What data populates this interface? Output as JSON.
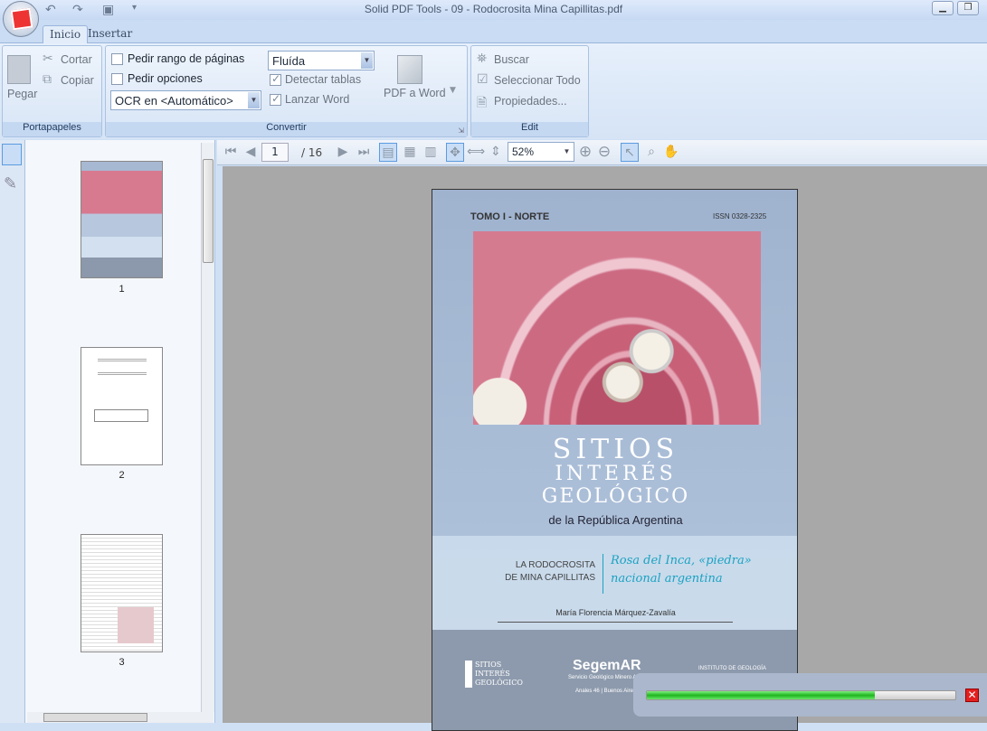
{
  "window": {
    "title": "Solid PDF Tools - 09 - Rodocrosita Mina Capillitas.pdf"
  },
  "tabs": [
    {
      "label": "Inicio",
      "active": true
    },
    {
      "label": "Insertar",
      "active": false
    }
  ],
  "ribbon": {
    "portapapeles": {
      "label": "Portapapeles",
      "paste": "Pegar",
      "cut": "Cortar",
      "copy": "Copiar"
    },
    "convertir": {
      "label": "Convertir",
      "page_range": "Pedir rango de páginas",
      "page_range_checked": false,
      "options": "Pedir opciones",
      "options_checked": false,
      "ocr": "OCR en <Automático>",
      "mode": "Fluída",
      "detect_tables": "Detectar tablas",
      "detect_tables_checked": true,
      "launch_word": "Lanzar Word",
      "launch_word_checked": true,
      "pdf_to_word": "PDF a Word"
    },
    "edit": {
      "label": "Edit",
      "search": "Buscar",
      "select_all": "Seleccionar Todo",
      "properties": "Propiedades..."
    }
  },
  "navigation": {
    "current_page": "1",
    "total_pages": "/ 16",
    "zoom": "52%"
  },
  "thumbnails": [
    {
      "label": "1"
    },
    {
      "label": "2"
    },
    {
      "label": "3"
    }
  ],
  "cover": {
    "tomo": "TOMO I - NORTE",
    "issn": "ISSN 0328-2325",
    "title1": "SITIOS",
    "title2": "INTERÉS",
    "title3": "GEOLÓGICO",
    "subtitle": "de la República Argentina",
    "topic1": "LA RODOCROSITA",
    "topic2": "DE MINA CAPILLITAS",
    "headline1": "Rosa del Inca, «piedra»",
    "headline2": "nacional argentina",
    "author": "María Florencia Márquez-Zavalía",
    "logo_left": "SITIOS INTERÉS GEOLÓGICO",
    "logo_center": "SegemAR",
    "logo_center_sub": "Servicio Geológico Minero Argentino",
    "logo_right": "INSTITUTO DE GEOLOGÍA",
    "footer": "Anales 46 | Buenos Aires"
  },
  "progress": {
    "percent": 74
  },
  "colors": {
    "accent": "#5b9be0",
    "headline": "#1aa3c2",
    "progress": "#22b822"
  }
}
